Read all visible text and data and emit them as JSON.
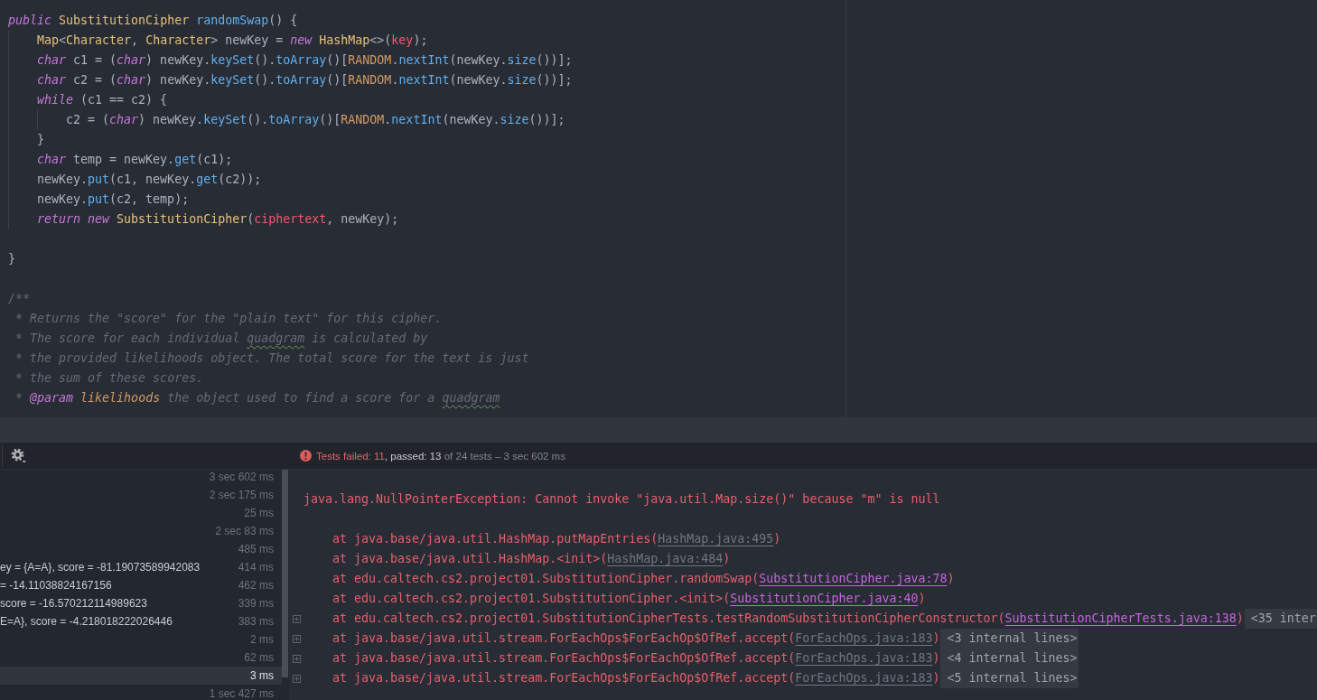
{
  "editor": {
    "blocks": [
      {
        "lines": [
          {
            "tokens": [
              {
                "text": "public",
                "kind": "keyword"
              },
              {
                "text": " SubstitutionCipher",
                "kind": "type"
              },
              {
                "text": " randomSwap",
                "kind": "method"
              },
              {
                "text": "() {",
                "kind": "plain"
              }
            ]
          },
          {
            "tokens": [
              {
                "text": "    Map",
                "kind": "type"
              },
              {
                "text": "<",
                "kind": "plain"
              },
              {
                "text": "Character",
                "kind": "type"
              },
              {
                "text": ", ",
                "kind": "plain"
              },
              {
                "text": "Character",
                "kind": "type"
              },
              {
                "text": "> newKey = ",
                "kind": "plain"
              },
              {
                "text": "new",
                "kind": "keyword"
              },
              {
                "text": " HashMap",
                "kind": "type"
              },
              {
                "text": "<>(",
                "kind": "plain"
              },
              {
                "text": "key",
                "kind": "field"
              },
              {
                "text": ");",
                "kind": "plain"
              }
            ]
          },
          {
            "tokens": [
              {
                "text": "    char",
                "kind": "keyword"
              },
              {
                "text": " c1 = (",
                "kind": "plain"
              },
              {
                "text": "char",
                "kind": "keyword"
              },
              {
                "text": ") newKey.",
                "kind": "plain"
              },
              {
                "text": "keySet",
                "kind": "call"
              },
              {
                "text": "().",
                "kind": "plain"
              },
              {
                "text": "toArray",
                "kind": "call"
              },
              {
                "text": "()[",
                "kind": "plain"
              },
              {
                "text": "RANDOM",
                "kind": "constant"
              },
              {
                "text": ".",
                "kind": "plain"
              },
              {
                "text": "nextInt",
                "kind": "call"
              },
              {
                "text": "(newKey.",
                "kind": "plain"
              },
              {
                "text": "size",
                "kind": "call"
              },
              {
                "text": "())];",
                "kind": "plain"
              }
            ]
          },
          {
            "tokens": [
              {
                "text": "    char",
                "kind": "keyword"
              },
              {
                "text": " c2 = (",
                "kind": "plain"
              },
              {
                "text": "char",
                "kind": "keyword"
              },
              {
                "text": ") newKey.",
                "kind": "plain"
              },
              {
                "text": "keySet",
                "kind": "call"
              },
              {
                "text": "().",
                "kind": "plain"
              },
              {
                "text": "toArray",
                "kind": "call"
              },
              {
                "text": "()[",
                "kind": "plain"
              },
              {
                "text": "RANDOM",
                "kind": "constant"
              },
              {
                "text": ".",
                "kind": "plain"
              },
              {
                "text": "nextInt",
                "kind": "call"
              },
              {
                "text": "(newKey.",
                "kind": "plain"
              },
              {
                "text": "size",
                "kind": "call"
              },
              {
                "text": "())];",
                "kind": "plain"
              }
            ]
          },
          {
            "tokens": [
              {
                "text": "    while",
                "kind": "keyword"
              },
              {
                "text": " (c1 == c2) {",
                "kind": "plain"
              }
            ]
          },
          {
            "tokens": [
              {
                "text": "        c2 = (",
                "kind": "plain"
              },
              {
                "text": "char",
                "kind": "keyword"
              },
              {
                "text": ") newKey.",
                "kind": "plain"
              },
              {
                "text": "keySet",
                "kind": "call"
              },
              {
                "text": "().",
                "kind": "plain"
              },
              {
                "text": "toArray",
                "kind": "call"
              },
              {
                "text": "()[",
                "kind": "plain"
              },
              {
                "text": "RANDOM",
                "kind": "constant"
              },
              {
                "text": ".",
                "kind": "plain"
              },
              {
                "text": "nextInt",
                "kind": "call"
              },
              {
                "text": "(newKey.",
                "kind": "plain"
              },
              {
                "text": "size",
                "kind": "call"
              },
              {
                "text": "())];",
                "kind": "plain"
              }
            ]
          },
          {
            "tokens": [
              {
                "text": "    }",
                "kind": "plain"
              }
            ]
          },
          {
            "tokens": [
              {
                "text": "    char",
                "kind": "keyword"
              },
              {
                "text": " temp = newKey.",
                "kind": "plain"
              },
              {
                "text": "get",
                "kind": "call"
              },
              {
                "text": "(c1);",
                "kind": "plain"
              }
            ]
          },
          {
            "tokens": [
              {
                "text": "    newKey.",
                "kind": "plain"
              },
              {
                "text": "put",
                "kind": "call"
              },
              {
                "text": "(c1, newKey.",
                "kind": "plain"
              },
              {
                "text": "get",
                "kind": "call"
              },
              {
                "text": "(c2));",
                "kind": "plain"
              }
            ]
          },
          {
            "tokens": [
              {
                "text": "    newKey.",
                "kind": "plain"
              },
              {
                "text": "put",
                "kind": "call"
              },
              {
                "text": "(c2, temp);",
                "kind": "plain"
              }
            ]
          },
          {
            "tokens": [
              {
                "text": "    return",
                "kind": "keyword"
              },
              {
                "text": " new",
                "kind": "keyword"
              },
              {
                "text": " SubstitutionCipher",
                "kind": "type"
              },
              {
                "text": "(",
                "kind": "plain"
              },
              {
                "text": "ciphertext",
                "kind": "field"
              },
              {
                "text": ", newKey);",
                "kind": "plain"
              }
            ]
          }
        ]
      },
      {
        "lines": [
          {
            "tokens": [
              {
                "text": "}",
                "kind": "plain"
              }
            ]
          }
        ]
      },
      {
        "lines": [
          {
            "tokens": [
              {
                "text": "/**",
                "kind": "comment"
              }
            ]
          },
          {
            "tokens": [
              {
                "text": " * Returns the \"score\" for the \"plain text\" for this cipher.",
                "kind": "comment"
              }
            ]
          },
          {
            "tokens": [
              {
                "text": " * The score for each individual ",
                "kind": "comment"
              },
              {
                "text": "quadgram",
                "kind": "typo"
              },
              {
                "text": " is calculated by",
                "kind": "comment"
              }
            ]
          },
          {
            "tokens": [
              {
                "text": " * the provided likelihoods object. The total score for the text is just",
                "kind": "comment"
              }
            ]
          },
          {
            "tokens": [
              {
                "text": " * the sum of these scores.",
                "kind": "comment"
              }
            ]
          },
          {
            "tokens": [
              {
                "text": " * ",
                "kind": "comment"
              },
              {
                "text": "@param",
                "kind": "doc_tag"
              },
              {
                "text": " likelihoods",
                "kind": "doc_param"
              },
              {
                "text": " the object used to find a score for a ",
                "kind": "comment"
              },
              {
                "text": "quadgram",
                "kind": "typo"
              }
            ]
          }
        ]
      }
    ]
  },
  "test_toolbar": {
    "has_failures": true,
    "status": [
      {
        "text": "Tests failed: 11",
        "kind": "failed"
      },
      {
        "text": ", passed: 13",
        "kind": "passed"
      },
      {
        "text": " of 24 tests – 3 sec 602 ms",
        "kind": "muted"
      }
    ]
  },
  "test_tree": {
    "rows": [
      {
        "duration": "3 sec 602 ms",
        "selected": false
      },
      {
        "duration": "2 sec 175 ms",
        "selected": false
      },
      {
        "duration": "25 ms",
        "selected": false
      },
      {
        "duration": "2 sec 83 ms",
        "selected": false
      },
      {
        "duration": "485 ms",
        "selected": false
      },
      {
        "label": "ey = {A=A}, score = -81.19073589942083",
        "duration": "414 ms",
        "selected": false
      },
      {
        "label": "= -14.11038824167156",
        "duration": "462 ms",
        "selected": false
      },
      {
        "label": "score = -16.570212114989623",
        "duration": "339 ms",
        "selected": false
      },
      {
        "label": "E=A}, score = -4.218018222026446",
        "duration": "383 ms",
        "selected": false
      },
      {
        "duration": "2 ms",
        "selected": false
      },
      {
        "duration": "62 ms",
        "selected": false
      },
      {
        "duration": "3 ms",
        "selected": true
      },
      {
        "duration": "1 sec 427 ms",
        "selected": false
      }
    ]
  },
  "console": {
    "message": "java.lang.NullPointerException: Cannot invoke \"java.util.Map.size()\" because \"m\" is null",
    "frames": [
      {
        "foldable": false,
        "parts": [
          {
            "text": "at java.base/java.util.HashMap.putMapEntries(",
            "kind": "text"
          },
          {
            "text": "HashMap.java:495",
            "kind": "library_link"
          },
          {
            "text": ")",
            "kind": "text"
          }
        ]
      },
      {
        "foldable": false,
        "parts": [
          {
            "text": "at java.base/java.util.HashMap.<init>(",
            "kind": "text"
          },
          {
            "text": "HashMap.java:484",
            "kind": "library_link"
          },
          {
            "text": ")",
            "kind": "text"
          }
        ]
      },
      {
        "foldable": false,
        "parts": [
          {
            "text": "at edu.caltech.cs2.project01.SubstitutionCipher.randomSwap(",
            "kind": "text"
          },
          {
            "text": "SubstitutionCipher.java:78",
            "kind": "user_link"
          },
          {
            "text": ")",
            "kind": "text"
          }
        ]
      },
      {
        "foldable": false,
        "parts": [
          {
            "text": "at edu.caltech.cs2.project01.SubstitutionCipher.<init>(",
            "kind": "text"
          },
          {
            "text": "SubstitutionCipher.java:40",
            "kind": "user_link"
          },
          {
            "text": ")",
            "kind": "text"
          }
        ]
      },
      {
        "foldable": true,
        "parts": [
          {
            "text": "at edu.caltech.cs2.project01.SubstitutionCipherTests.testRandomSubstitutionCipherConstructor(",
            "kind": "text"
          },
          {
            "text": "SubstitutionCipherTests.java:138",
            "kind": "user_link"
          },
          {
            "text": ")",
            "kind": "text"
          }
        ],
        "folded": "<35 inter"
      },
      {
        "foldable": true,
        "parts": [
          {
            "text": "at java.base/java.util.stream.ForEachOps$ForEachOp$OfRef.accept(",
            "kind": "text"
          },
          {
            "text": "ForEachOps.java:183",
            "kind": "library_link"
          },
          {
            "text": ")",
            "kind": "text"
          }
        ],
        "folded": "<3 internal lines>"
      },
      {
        "foldable": true,
        "parts": [
          {
            "text": "at java.base/java.util.stream.ForEachOps$ForEachOp$OfRef.accept(",
            "kind": "text"
          },
          {
            "text": "ForEachOps.java:183",
            "kind": "library_link"
          },
          {
            "text": ")",
            "kind": "text"
          }
        ],
        "folded": "<4 internal lines>"
      },
      {
        "foldable": true,
        "parts": [
          {
            "text": "at java.base/java.util.stream.ForEachOps$ForEachOp$OfRef.accept(",
            "kind": "text"
          },
          {
            "text": "ForEachOps.java:183",
            "kind": "library_link"
          },
          {
            "text": ")",
            "kind": "text"
          }
        ],
        "folded": "<5 internal lines>"
      }
    ]
  }
}
